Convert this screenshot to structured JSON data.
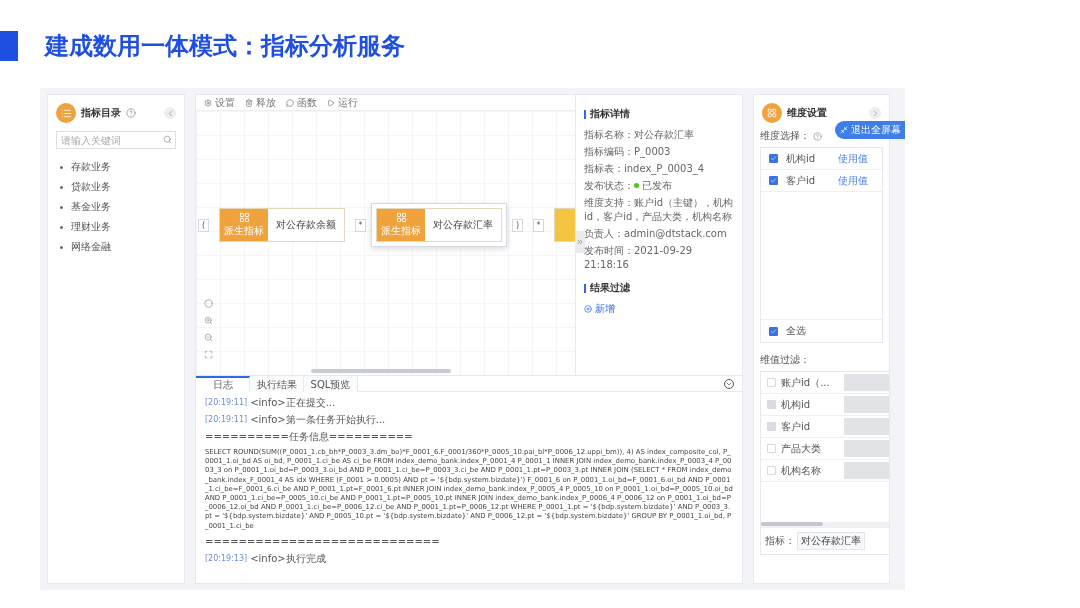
{
  "title": "建成数用一体模式：指标分析服务",
  "catalog": {
    "title": "指标目录",
    "search": {
      "placeholder": "请输入关键词"
    },
    "items": [
      "存款业务",
      "贷款业务",
      "基金业务",
      "理财业务",
      "网络金融"
    ]
  },
  "toolbar": [
    {
      "kind": "settings",
      "label": "设置"
    },
    {
      "kind": "delete",
      "label": "释放"
    },
    {
      "kind": "function",
      "label": "函数"
    },
    {
      "kind": "run",
      "label": "运行"
    }
  ],
  "formula": [
    {
      "kind": "token",
      "text": "("
    },
    {
      "kind": "node",
      "label": "对公存款余额",
      "tag": "派生指标",
      "color": "#f0a23c",
      "selected": false
    },
    {
      "kind": "token",
      "text": "*"
    },
    {
      "kind": "node",
      "label": "对公存款汇率",
      "tag": "派生指标",
      "color": "#f0a23c",
      "selected": true
    },
    {
      "kind": "token",
      "text": ")"
    },
    {
      "kind": "token",
      "text": "*"
    },
    {
      "kind": "node",
      "color": "#f5c542",
      "selected": false
    }
  ],
  "details": {
    "title": "指标详情",
    "fields": [
      {
        "kind": "text",
        "label": "指标名称：",
        "value": "对公存款汇率"
      },
      {
        "kind": "text",
        "label": "指标编码：",
        "value": "P_0003"
      },
      {
        "kind": "text",
        "label": "指标表：",
        "value": "index_P_0003_4"
      },
      {
        "kind": "status",
        "label": "发布状态：",
        "value": "已发布",
        "color": "#52c41a"
      },
      {
        "kind": "text",
        "label": "维度支持：",
        "value": "账户id（主键），机构id，客户id，产品大类，机构名称"
      },
      {
        "kind": "text",
        "label": "负责人：",
        "value": "admin@dtstack.com"
      },
      {
        "kind": "text",
        "label": "发布时间：",
        "value": "2021-09-29 21:18:16"
      }
    ]
  },
  "result_filter": {
    "title": "结果过滤",
    "add": "新增"
  },
  "log": {
    "tabs": [
      {
        "label": "日志",
        "selected": true
      },
      {
        "label": "执行结果",
        "selected": false
      },
      {
        "label": "SQL预览",
        "selected": false
      }
    ],
    "lines": [
      {
        "kind": "entry",
        "time": "[20:19:11]",
        "text": "<info>正在提交..."
      },
      {
        "kind": "entry",
        "time": "[20:19:11]",
        "text": "<info>第一条任务开始执行..."
      },
      {
        "kind": "plain",
        "text": "==========任务信息=========="
      },
      {
        "kind": "plain",
        "text": "SELECT ROUND(SUM((P_0001_1.cb_bh*P_0003_3.dm_bo)*F_0001_6.F_0001/360*P_0005_10.pai_bl*P_0006_12.uppi_bm)), 4) AS index_composite_col, P_0001_1.oi_bd AS oi_bd, P_0001_1.ci_be AS ci_be FROM index_demo_bank.index_P_0001_4 P_0001_1 INNER JOIN index_demo_bank.index_P_0003_4 P_0003_3 on P_0001_1.oi_bd=P_0003_3.oi_bd AND P_0001_1.ci_be=P_0003_3.ci_be AND P_0001_1.pt=P_0003_3.pt INNER JOIN (SELECT * FROM index_demo_bank.index_F_0001_4 AS idx WHERE (F_0001 > 0.0005) AND pt = '${bdp.system.bizdate}') F_0001_6 on P_0001_1.oi_bd=F_0001_6.oi_bd AND P_0001_1.ci_be=F_0001_6.ci_be AND P_0001_1.pt=F_0001_6.pt INNER JOIN index_demo_bank.index_P_0005_4 P_0005_10 on P_0001_1.oi_bd=P_0005_10.oi_bd AND P_0001_1.ci_be=P_0005_10.ci_be AND P_0001_1.pt=P_0005_10.pt INNER JOIN index_demo_bank.index_P_0006_4 P_0006_12 on P_0001_1.oi_bd=P_0006_12.oi_bd AND P_0001_1.ci_be=P_0006_12.ci_be AND P_0001_1.pt=P_0006_12.pt WHERE P_0001_1.pt = '${bdp.system.bizdate}' AND P_0003_3.pt = '${bdp.system.bizdate}' AND P_0005_10.pt = '${bdp.system.bizdate}' AND P_0006_12.pt = '${bdp.system.bizdate}' GROUP BY P_0001_1.oi_bd, P_0001_1.ci_be"
      },
      {
        "kind": "plain",
        "text": "============================"
      },
      {
        "kind": "entry",
        "time": "[20:19:13]",
        "text": "<info>执行完成"
      }
    ]
  },
  "dimensions": {
    "title": "维度设置",
    "select_label": "维度选择：",
    "items": [
      {
        "name": "机构id",
        "action": "使用值",
        "checked": true
      },
      {
        "name": "客户id",
        "action": "使用值",
        "checked": true
      }
    ],
    "select_all": {
      "label": "全选",
      "checked": true
    },
    "filter_label": "维值过滤：",
    "filters": [
      {
        "name": "账户id（...",
        "checked": false,
        "disabled": false
      },
      {
        "name": "机构id",
        "checked": false,
        "disabled": true
      },
      {
        "name": "客户id",
        "checked": false,
        "disabled": true
      },
      {
        "name": "产品大类",
        "checked": false,
        "disabled": false
      },
      {
        "name": "机构名称",
        "checked": false,
        "disabled": false
      }
    ],
    "footer_label": "指标：",
    "footer_value": "对公存款汇率"
  },
  "fullscreen_button": "退出全屏幕"
}
